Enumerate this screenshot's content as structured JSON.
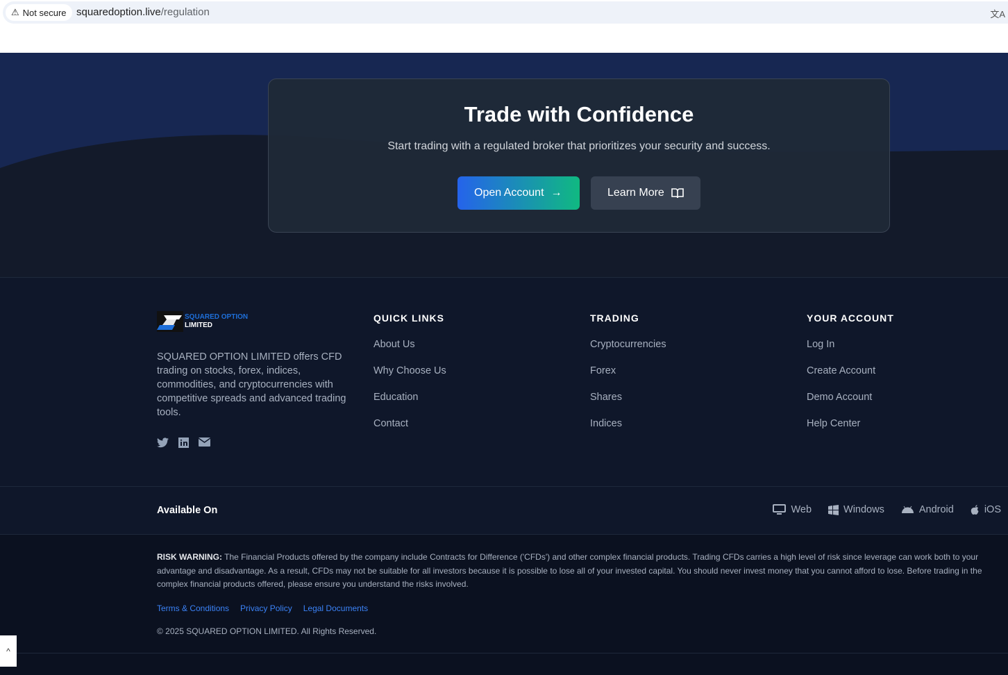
{
  "browser": {
    "security": "Not secure",
    "url_host": "squaredoption.live",
    "url_path": "/regulation"
  },
  "cta": {
    "title": "Trade with Confidence",
    "subtitle": "Start trading with a regulated broker that prioritizes your security and success.",
    "open_account": "Open Account",
    "learn_more": "Learn More"
  },
  "footer": {
    "logo": {
      "line1": "SQUARED OPTION",
      "line2": "LIMITED"
    },
    "about": "SQUARED OPTION LIMITED offers CFD trading on stocks, forex, indices, commodities, and cryptocurrencies with competitive spreads and advanced trading tools.",
    "columns": [
      {
        "title": "QUICK LINKS",
        "links": [
          "About Us",
          "Why Choose Us",
          "Education",
          "Contact"
        ]
      },
      {
        "title": "TRADING",
        "links": [
          "Cryptocurrencies",
          "Forex",
          "Shares",
          "Indices"
        ]
      },
      {
        "title": "YOUR ACCOUNT",
        "links": [
          "Log In",
          "Create Account",
          "Demo Account",
          "Help Center"
        ]
      }
    ],
    "available_on": "Available On",
    "platforms": [
      "Web",
      "Windows",
      "Android",
      "iOS"
    ],
    "risk_label": "RISK WARNING:",
    "risk_text": " The Financial Products offered by the company include Contracts for Difference ('CFDs') and other complex financial products. Trading CFDs carries a high level of risk since leverage can work both to your advantage and disadvantage. As a result, CFDs may not be suitable for all investors because it is possible to lose all of your invested capital. You should never invest money that you cannot afford to lose. Before trading in the complex financial products offered, please ensure you understand the risks involved.",
    "legal_links": [
      "Terms & Conditions",
      "Privacy Policy",
      "Legal Documents"
    ],
    "copyright": "© 2025 SQUARED OPTION LIMITED. All Rights Reserved."
  },
  "colors": {
    "accent_blue": "#2563eb",
    "accent_green": "#10b981",
    "link": "#3b82f6"
  }
}
